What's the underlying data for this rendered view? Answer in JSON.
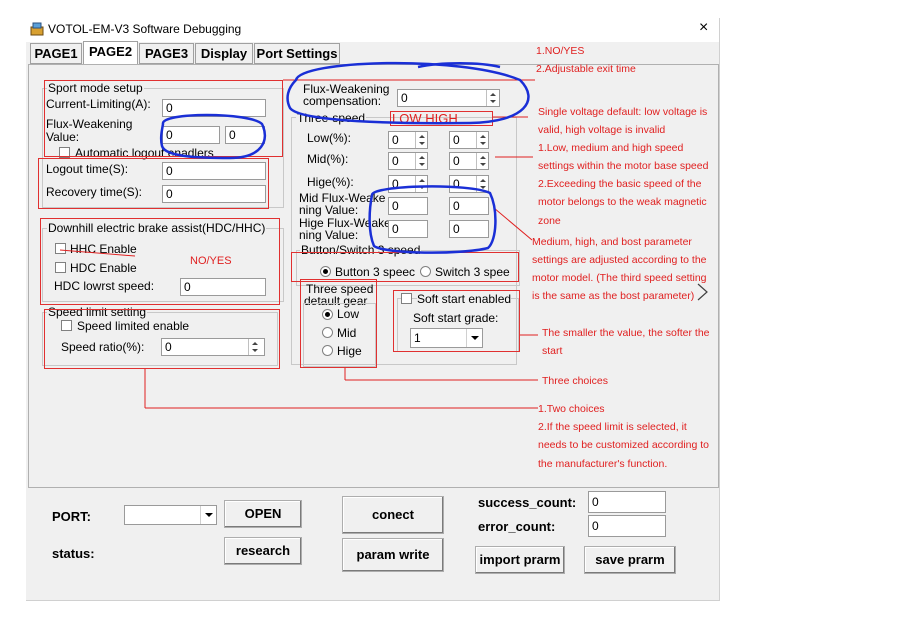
{
  "window": {
    "title": "VOTOL-EM-V3 Software Debugging",
    "close": "×"
  },
  "tabs": [
    {
      "label": "PAGE1"
    },
    {
      "label": "PAGE2"
    },
    {
      "label": "PAGE3"
    },
    {
      "label": "Display"
    },
    {
      "label": "Port Settings"
    }
  ],
  "sport": {
    "group": "Sport mode setup",
    "current_limiting_label": "Current-Limiting(A):",
    "current_limiting_value": "0",
    "flux_label_1": "Flux-Weakening",
    "flux_label_2": "Value:",
    "flux_value_1": "0",
    "flux_value_2": "0",
    "auto_logout_label": "Automatic logout enadlers",
    "logout_label": "Logout time(S):",
    "logout_value": "0",
    "recovery_label": "Recovery time(S):",
    "recovery_value": "0"
  },
  "downhill": {
    "group": "Downhill electric brake assist(HDC/HHC)",
    "hhc_label": "HHC Enable",
    "hdc_label": "HDC Enable",
    "hdc_lowest_label": "HDC lowrst speed:",
    "hdc_lowest_value": "0"
  },
  "speed_limit": {
    "group": "Speed limit setting",
    "enable_label": "Speed limited enable",
    "ratio_label": "Speed ratio(%):",
    "ratio_value": "0"
  },
  "fluxcomp": {
    "label_1": "Flux-Weakening",
    "label_2": "compensation:",
    "value": "0"
  },
  "three_speed": {
    "group": "Three-speed",
    "low_label": "Low(%):",
    "low_a": "0",
    "low_b": "0",
    "mid_label": "Mid(%):",
    "mid_a": "0",
    "mid_b": "0",
    "hige_label": "Hige(%):",
    "hige_a": "0",
    "hige_b": "0",
    "mid_flux_label_1": "Mid Flux-Weake",
    "mid_flux_label_2": "ning Value:",
    "mid_flux_a": "0",
    "mid_flux_b": "0",
    "hige_flux_label_1": "Hige Flux-Weake",
    "hige_flux_label_2": "ning Value:",
    "hige_flux_a": "0",
    "hige_flux_b": "0"
  },
  "button_switch": {
    "group": "Button/Switch 3 speed",
    "button_label": "Button 3 speec",
    "switch_label": "Switch 3 spee"
  },
  "default_gear": {
    "label_1": "Three speed",
    "label_2": "detault gear",
    "low": "Low",
    "mid": "Mid",
    "hige": "Hige"
  },
  "soft_start": {
    "enabled_label": "Soft start enabled",
    "grade_label": "Soft start grade:",
    "grade_value": "1"
  },
  "port": {
    "port_label": "PORT:",
    "port_value": "",
    "open_button": "OPEN",
    "status_label": "status:",
    "research_button": "research",
    "connect_button": "conect",
    "param_write_button": "param write",
    "success_label": "success_count:",
    "success_value": "0",
    "error_label": "error_count:",
    "error_value": "0",
    "import_button": "import prarm",
    "save_button": "save prarm"
  },
  "annotations": {
    "lowhigh": "LOW    HIGH",
    "noyes_inline": "NO/YES",
    "notes_top": [
      "1.NO/YES",
      "2.Adjustable exit time"
    ],
    "notes_speed": [
      "Single voltage default: low voltage is",
      "valid, high voltage is invalid",
      "1.Low, medium and high speed",
      "settings within the motor base speed",
      "2.Exceeding the basic speed of the",
      "motor belongs to the weak magnetic",
      "zone",
      "Medium, high, and bost parameter",
      "settings are adjusted according to the",
      "motor model. (The third speed setting",
      "is the same as the bost parameter)"
    ],
    "notes_soft": [
      "The smaller the value, the softer the",
      "start"
    ],
    "note_three": "Three choices",
    "notes_limit": [
      "1.Two choices",
      "2.If the speed limit is selected, it",
      "needs to be customized according to",
      "the manufacturer's function."
    ],
    "colors": {
      "annotation": "#e02020",
      "ink": "#1a2fd6"
    }
  }
}
